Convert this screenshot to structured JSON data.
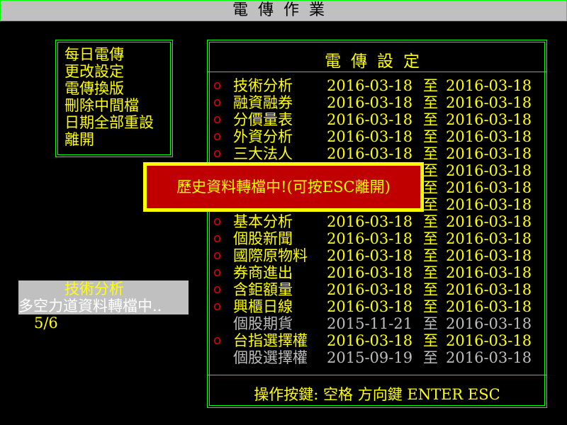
{
  "app": {
    "title": "電傳作業"
  },
  "menu": {
    "items": [
      "每日電傳",
      "更改設定",
      "電傳換版",
      "刪除中間檔",
      "日期全部重設",
      "離開"
    ]
  },
  "settings": {
    "title": "電傳設定",
    "to_label": "至",
    "check_mark": "o",
    "rows": [
      {
        "name": "技術分析",
        "start": "2016-03-18",
        "end": "2016-03-18",
        "checked": true
      },
      {
        "name": "融資融券",
        "start": "2016-03-18",
        "end": "2016-03-18",
        "checked": true
      },
      {
        "name": "分價量表",
        "start": "2016-03-18",
        "end": "2016-03-18",
        "checked": true
      },
      {
        "name": "外資分析",
        "start": "2016-03-18",
        "end": "2016-03-18",
        "checked": true
      },
      {
        "name": "三大法人",
        "start": "2016-03-18",
        "end": "2016-03-18",
        "checked": true
      },
      {
        "name": "",
        "start": "",
        "end": "2016-03-18",
        "checked": false
      },
      {
        "name": "",
        "start": "",
        "end": "2016-03-18",
        "checked": false
      },
      {
        "name": "",
        "start": "",
        "end": "2016-03-18",
        "checked": false
      },
      {
        "name": "基本分析",
        "start": "2016-03-18",
        "end": "2016-03-18",
        "checked": true
      },
      {
        "name": "個股新聞",
        "start": "2016-03-18",
        "end": "2016-03-18",
        "checked": true
      },
      {
        "name": "國際原物料",
        "start": "2016-03-18",
        "end": "2016-03-18",
        "checked": true
      },
      {
        "name": "券商進出",
        "start": "2016-03-18",
        "end": "2016-03-18",
        "checked": true
      },
      {
        "name": "含鉅額量",
        "start": "2016-03-18",
        "end": "2016-03-18",
        "checked": true
      },
      {
        "name": "興櫃日線",
        "start": "2016-03-18",
        "end": "2016-03-18",
        "checked": true
      },
      {
        "name": "個股期貨",
        "start": "2015-11-21",
        "end": "2016-03-18",
        "checked": false
      },
      {
        "name": "台指選擇權",
        "start": "2016-03-18",
        "end": "2016-03-18",
        "checked": true
      },
      {
        "name": "個股選擇權",
        "start": "2015-09-19",
        "end": "2016-03-18",
        "checked": false
      }
    ],
    "footer": "操作按鍵: 空格 方向鍵 ENTER ESC"
  },
  "status": {
    "title": "技術分析",
    "message": "多空力道資料轉檔中..",
    "progress": "5/6"
  },
  "dialog": {
    "message": "歷史資料轉檔中!(可按ESC離開)"
  },
  "colors": {
    "text": "#ffff00",
    "border": "#00ff00",
    "check": "#e00000",
    "disabled": "#bdbdbd",
    "dialog_bg": "#c00000",
    "bar_bg": "#c0c0c0"
  }
}
